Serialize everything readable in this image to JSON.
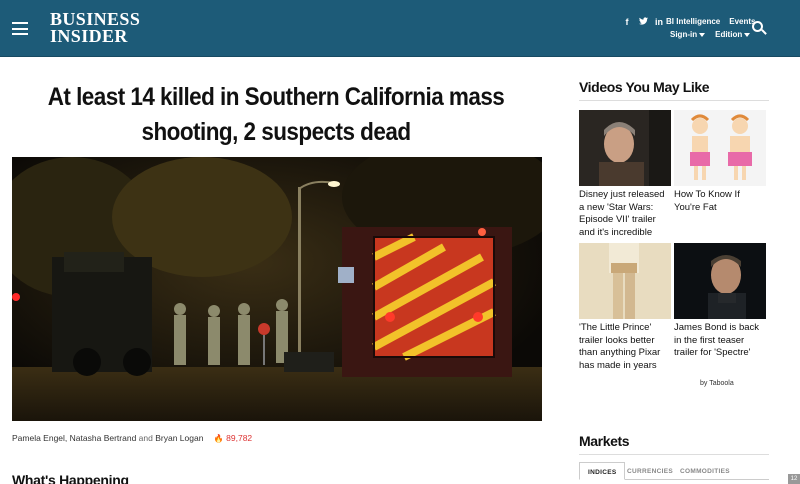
{
  "header": {
    "brand_line1": "BUSINESS",
    "brand_line2": "INSIDER",
    "links": [
      "BI Intelligence",
      "Events"
    ],
    "signin_label": "Sign-in",
    "edition_label": "Edition",
    "social": [
      "facebook-icon",
      "twitter-icon",
      "linkedin-icon"
    ],
    "brand_color": "#1d5b78"
  },
  "article": {
    "headline": "At least 14 killed in Southern California mass shooting, 2 suspects dead",
    "authors": [
      "Pamela Engel",
      "Natasha Bertrand",
      "Bryan Logan"
    ],
    "author_sep": ",",
    "author_and": "and",
    "views": "89,782",
    "next_section": "What's Happening"
  },
  "videos": {
    "heading": "Videos You May Like",
    "items": [
      {
        "title": "Disney just released a new 'Star Wars: Episode VII' trailer and it's incredible"
      },
      {
        "title": "How To Know If You're Fat"
      },
      {
        "title": "'The Little Prince' trailer looks better than anything Pixar has made in years"
      },
      {
        "title": "James Bond is back in the first teaser trailer for 'Spectre'"
      }
    ],
    "attribution": "by Taboola"
  },
  "markets": {
    "heading": "Markets",
    "tabs": [
      "INDICES",
      "CURRENCIES",
      "COMMODITIES"
    ],
    "active_tab": "INDICES"
  },
  "page_badge": "12"
}
